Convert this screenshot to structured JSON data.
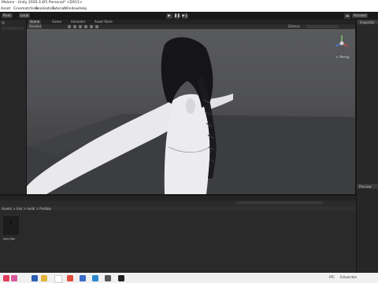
{
  "window": {
    "title": "Malone - Unity 2020.3.4f1 Personal* <DX11>"
  },
  "menu": [
    "Asset",
    "Cinematchine",
    "Realisation",
    "Tutorial",
    "Window",
    "Help"
  ],
  "toolbar": {
    "pivot_label": "Pivot",
    "local_label": "Local",
    "account_label": "Account"
  },
  "center_tabs": [
    "Scene",
    "Game",
    "Animator",
    "Asset Store"
  ],
  "scene_toolbar": {
    "shading_label": "Shaded",
    "gizmos_label": "Gizmos",
    "persp_label": "< Persp"
  },
  "right_panel": {
    "inspector_label": "Inspector",
    "preview_label": "Preview"
  },
  "bottom_panel": {
    "breadcrumb": "Assets > hair > heidi > Prefabs",
    "asset_label": "hairy.fbx"
  },
  "taskbar": {
    "locale_label": "IPC",
    "user_label": "Eduardas"
  },
  "colors": {
    "accent": "#3a72b0",
    "viewport_floor": "#3c3d40",
    "model_skin": "#e9e9ec",
    "hair": "#151416"
  }
}
